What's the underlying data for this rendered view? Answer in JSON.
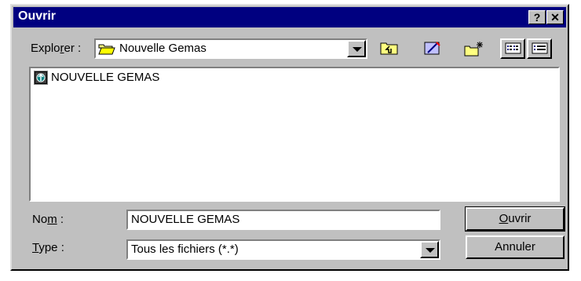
{
  "dialog": {
    "title": "Ouvrir",
    "help_button": "?",
    "close_button": "✕"
  },
  "lookin": {
    "label_pre": "Explo",
    "label_ul": "r",
    "label_post": "er :",
    "value": "Nouvelle Gemas"
  },
  "toolbar": {
    "icons": [
      "up-folder-icon",
      "desktop-icon",
      "new-folder-icon",
      "list-view-icon",
      "details-view-icon"
    ]
  },
  "file_list": {
    "items": [
      {
        "name": "NOUVELLE GEMAS",
        "icon": "application-icon"
      }
    ]
  },
  "filename": {
    "label_pre": "No",
    "label_ul": "m",
    "label_post": " :",
    "value": "NOUVELLE GEMAS"
  },
  "filetype": {
    "label_ul": "T",
    "label_post": "ype :",
    "value": "Tous les fichiers (*.*)"
  },
  "buttons": {
    "open_ul": "O",
    "open_rest": "uvrir",
    "cancel": "Annuler"
  }
}
